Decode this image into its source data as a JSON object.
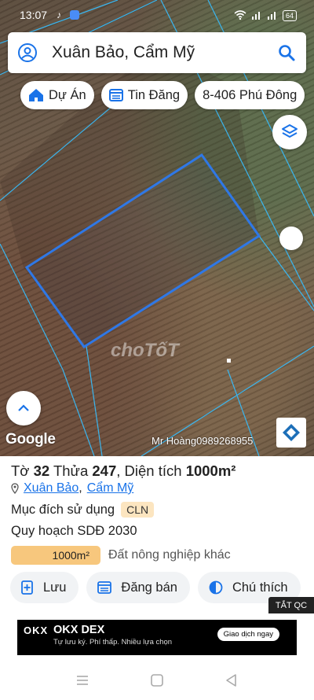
{
  "status_bar": {
    "time": "13:07",
    "battery": "64"
  },
  "search": {
    "query": "Xuân Bảo, Cẩm Mỹ"
  },
  "chips": [
    {
      "label": "Dự Án",
      "icon": "home-icon"
    },
    {
      "label": "Tin Đăng",
      "icon": "listing-icon"
    },
    {
      "label": "8-406 Phú Đông",
      "icon": ""
    }
  ],
  "map": {
    "attribution": "Google",
    "contact": "Mr Hoàng0989268955",
    "watermark": "choTốT"
  },
  "parcel": {
    "to_label": "Tờ",
    "to_value": "32",
    "thua_label": "Thửa",
    "thua_value": "247",
    "area_label": "Diện tích",
    "area_value": "1000m²",
    "commune": "Xuân Bảo",
    "separator": ",",
    "district": "Cẩm Mỹ",
    "purpose_label": "Mục đích sử dụng",
    "purpose_code": "CLN",
    "plan_label": "Quy hoạch SDĐ 2030",
    "plan_area": "1000m²",
    "plan_type": "Đất nông nghiệp khác"
  },
  "actions": [
    {
      "label": "Lưu",
      "icon": "bookmark-add-icon"
    },
    {
      "label": "Đăng bán",
      "icon": "post-icon"
    },
    {
      "label": "Chú thích",
      "icon": "legend-icon"
    }
  ],
  "ad": {
    "close_label": "TẮT QC",
    "brand": "OKX",
    "title": "OKX DEX",
    "subtitle": "Tự lưu ký. Phí thấp. Nhiều lựa chọn",
    "cta": "Giao dịch ngay"
  },
  "colors": {
    "accent": "#1a73e8",
    "cln_badge": "#fce5c0",
    "area_pill": "#f7c77d",
    "parcel_line": "#2f78e6"
  }
}
